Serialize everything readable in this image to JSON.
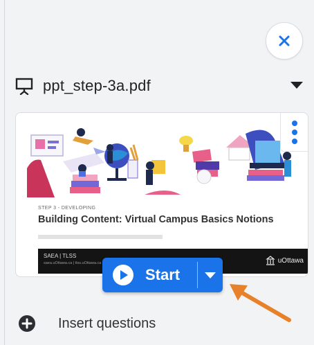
{
  "close_button": {
    "icon": "close-icon",
    "color": "#1a73e8"
  },
  "file": {
    "name": "ppt_step-3a.pdf",
    "icon": "presenter-icon"
  },
  "slide": {
    "step_label": "STEP 3 - DEVELOPING",
    "title": "Building Content: Virtual Campus Basics Notions",
    "footer_name": "SAEA | TLSS",
    "footer_sub": "saea.uOttawa.ca | tlss.uOttawa.ca",
    "footer_logo": "uOttawa"
  },
  "start_button": {
    "label": "Start",
    "color": "#1a73e8"
  },
  "insert": {
    "label": "Insert questions"
  },
  "colors": {
    "accent": "#1a73e8",
    "annotation": "#e8822a",
    "background": "#f1f3f4"
  }
}
